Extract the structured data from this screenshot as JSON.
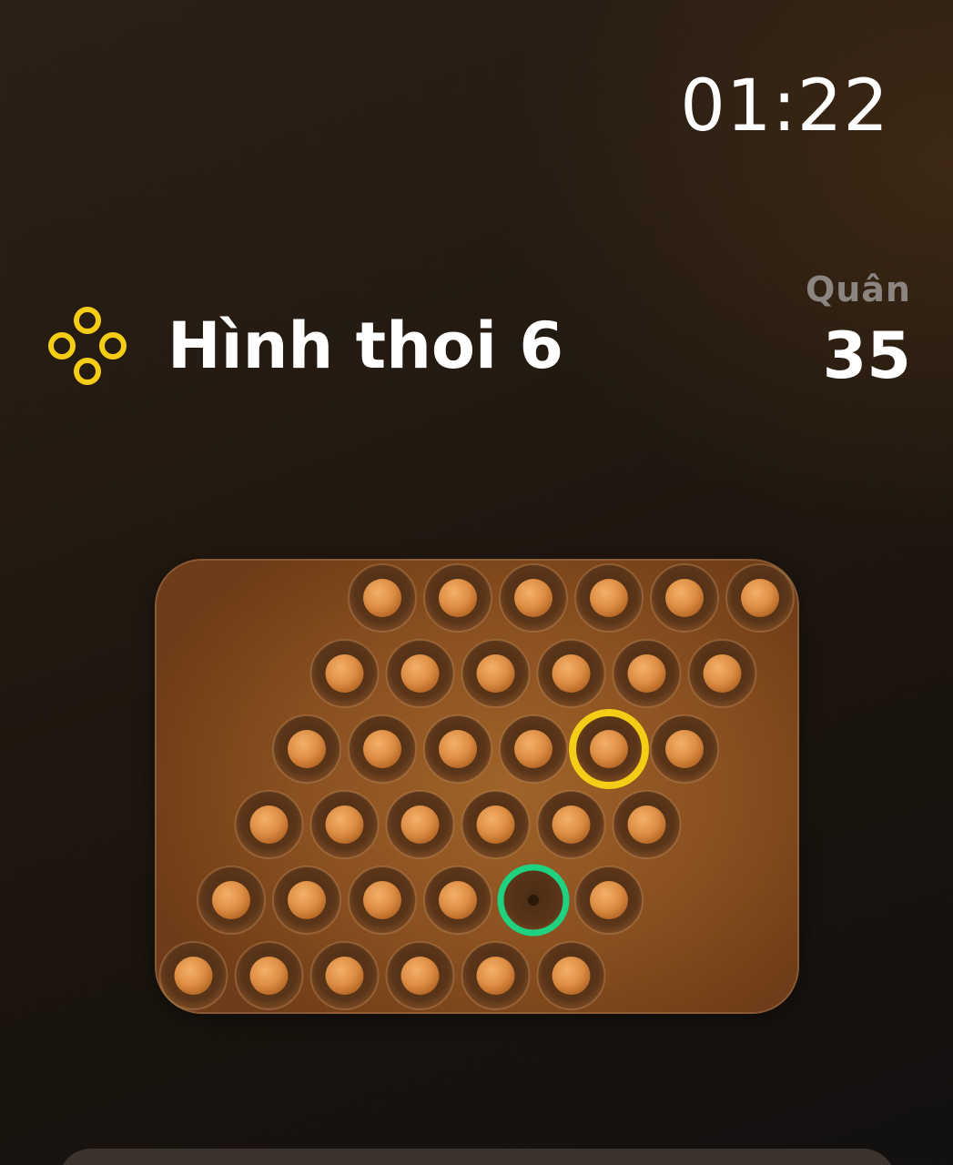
{
  "clock": "01:22",
  "puzzle": {
    "title": "Hình thoi 6",
    "icon": "four-rings-icon"
  },
  "pieces": {
    "label": "Quân",
    "count": "35"
  },
  "colors": {
    "accent_selected": "#f5cc16",
    "accent_target": "#1fd27f",
    "peg": "#e0914a",
    "board": "#8a5020"
  },
  "board": {
    "rows": 6,
    "cols": 6,
    "empty": [
      [
        4,
        4
      ]
    ],
    "selected": [
      2,
      4
    ],
    "target": [
      4,
      4
    ]
  }
}
